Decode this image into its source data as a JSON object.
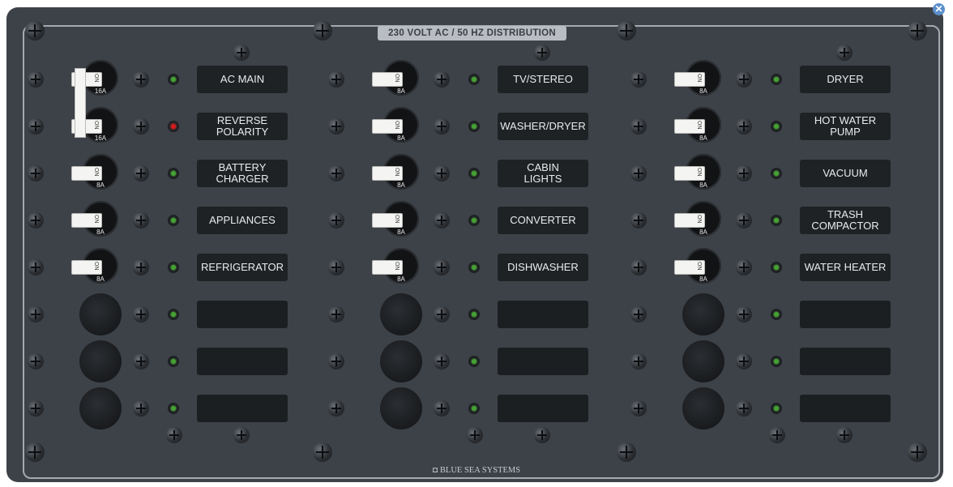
{
  "panel": {
    "title": "230 VOLT AC / 50 HZ DISTRIBUTION",
    "brand": "BLUE SEA SYSTEMS",
    "brand_icon": "blue-sea-logo-icon"
  },
  "columns": [
    {
      "rows": [
        {
          "label": "AC MAIN",
          "amps": "16A",
          "led": "green"
        },
        {
          "label": "REVERSE\nPOLARITY",
          "amps": "16A",
          "led": "red"
        },
        {
          "label": "BATTERY\nCHARGER",
          "amps": "8A",
          "led": "green"
        },
        {
          "label": "APPLIANCES",
          "amps": "8A",
          "led": "green"
        },
        {
          "label": "REFRIGERATOR",
          "amps": "8A",
          "led": "green"
        },
        {
          "label": "",
          "amps": "",
          "led": "green"
        },
        {
          "label": "",
          "amps": "",
          "led": "green"
        },
        {
          "label": "",
          "amps": "",
          "led": "green"
        }
      ]
    },
    {
      "rows": [
        {
          "label": "TV/STEREO",
          "amps": "8A",
          "led": "green"
        },
        {
          "label": "WASHER/DRYER",
          "amps": "8A",
          "led": "green"
        },
        {
          "label": "CABIN\nLIGHTS",
          "amps": "8A",
          "led": "green"
        },
        {
          "label": "CONVERTER",
          "amps": "8A",
          "led": "green"
        },
        {
          "label": "DISHWASHER",
          "amps": "8A",
          "led": "green"
        },
        {
          "label": "",
          "amps": "",
          "led": "green"
        },
        {
          "label": "",
          "amps": "",
          "led": "green"
        },
        {
          "label": "",
          "amps": "",
          "led": "green"
        }
      ]
    },
    {
      "rows": [
        {
          "label": "DRYER",
          "amps": "8A",
          "led": "green"
        },
        {
          "label": "HOT WATER\nPUMP",
          "amps": "8A",
          "led": "green"
        },
        {
          "label": "VACUUM",
          "amps": "8A",
          "led": "green"
        },
        {
          "label": "TRASH\nCOMPACTOR",
          "amps": "8A",
          "led": "green"
        },
        {
          "label": "WATER HEATER",
          "amps": "8A",
          "led": "green"
        },
        {
          "label": "",
          "amps": "",
          "led": "green"
        },
        {
          "label": "",
          "amps": "",
          "led": "green"
        },
        {
          "label": "",
          "amps": "",
          "led": "green"
        }
      ]
    }
  ],
  "rocker_text": "ON",
  "close_icon": "close-icon",
  "colors": {
    "panel": "#3d4248",
    "led_on": "#44a232",
    "led_alert": "#d51b1b",
    "label_bg": "#1f2225"
  }
}
